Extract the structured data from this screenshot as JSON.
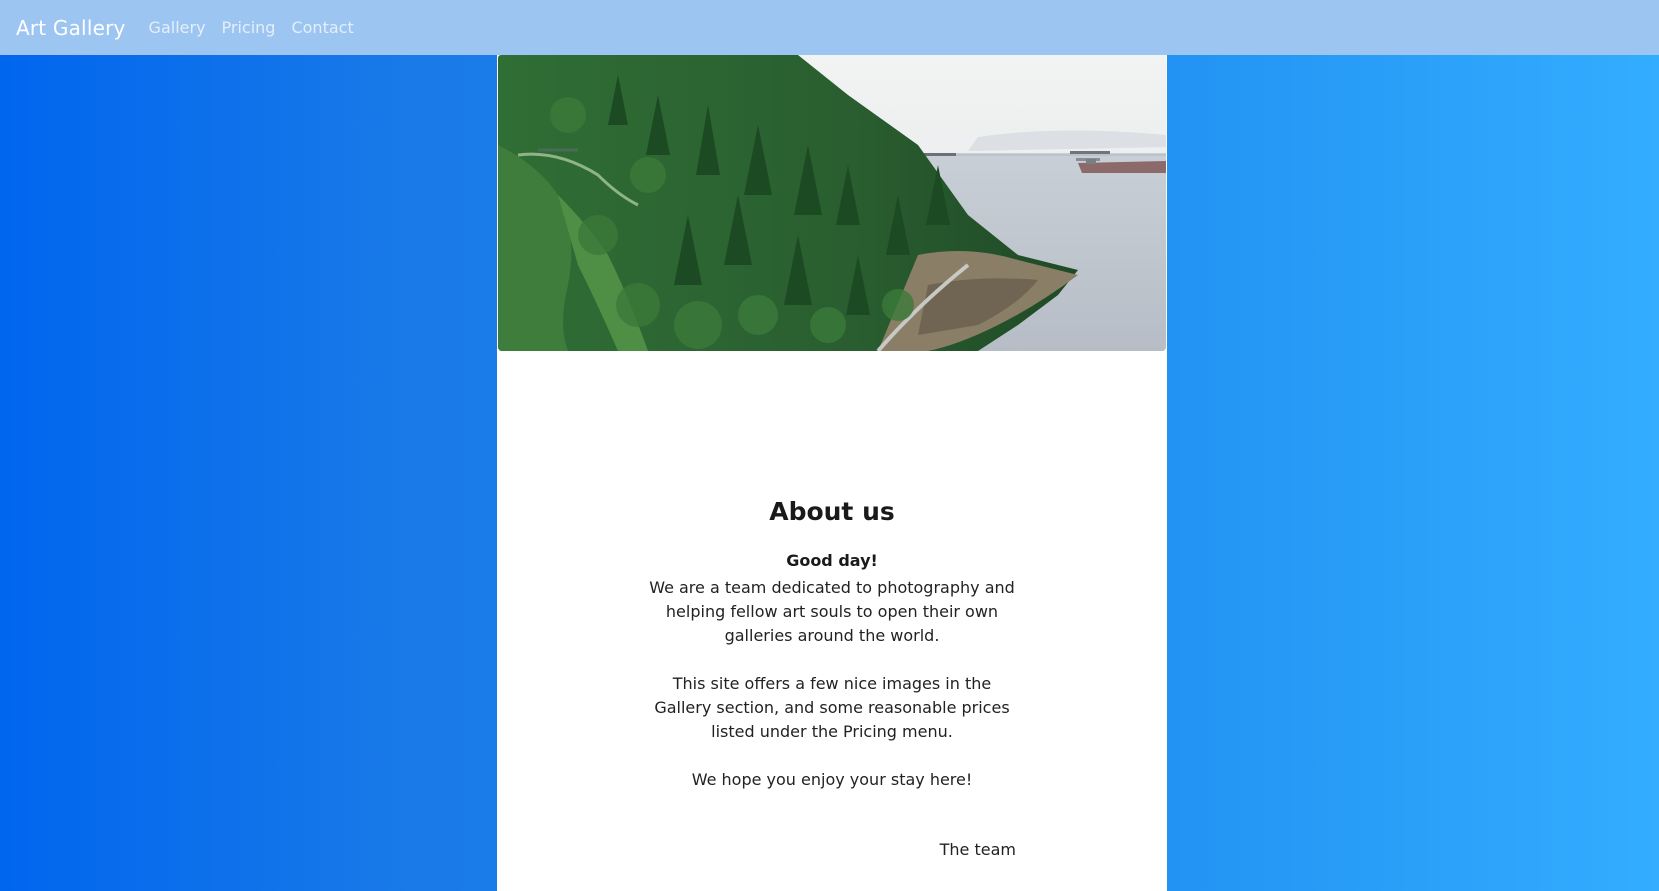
{
  "navbar": {
    "brand": "Art Gallery",
    "links": [
      {
        "label": "Gallery"
      },
      {
        "label": "Pricing"
      },
      {
        "label": "Contact"
      }
    ]
  },
  "hero": {
    "description": "Forested cliff above a rocky shoreline with cargo ships on the water"
  },
  "about": {
    "title": "About us",
    "greeting": "Good day!",
    "paragraphs": [
      "We are a team dedicated to photography and helping fellow art souls to open their own galleries around the world.",
      "This site offers a few nice images in the Gallery section, and some reasonable prices listed under the Pricing menu.",
      "We hope you enjoy your stay here!"
    ],
    "signature": "The team"
  },
  "colors": {
    "navbar_bg": "#9cc5f1",
    "gradient_left": "#0066ee",
    "gradient_right": "#33adff",
    "text": "#222222"
  }
}
